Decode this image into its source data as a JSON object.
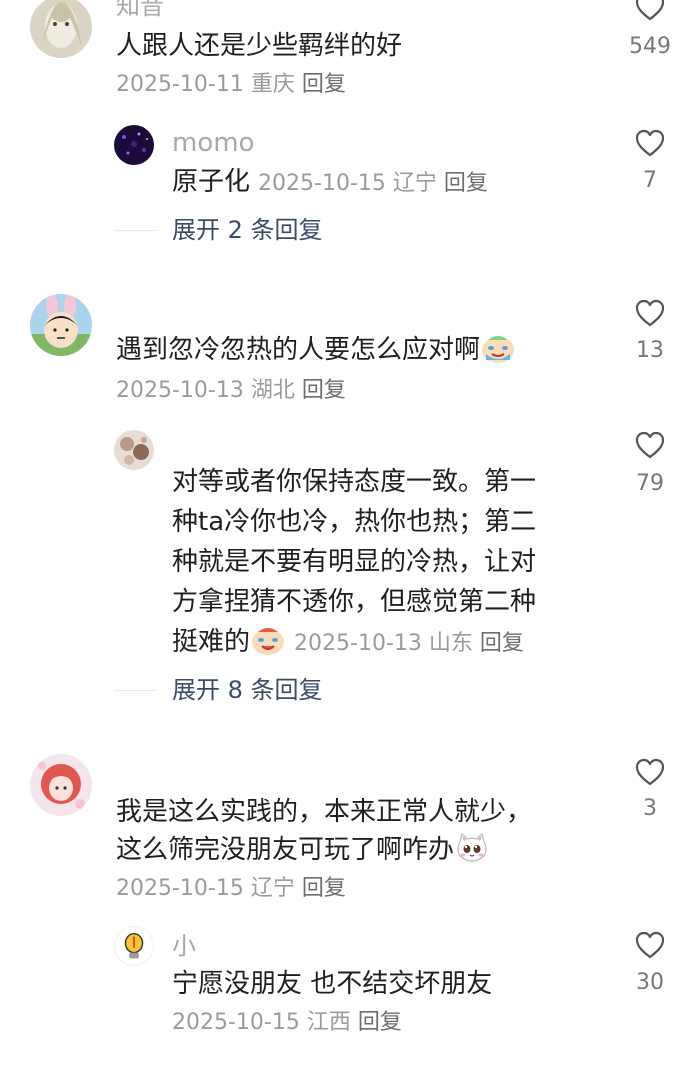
{
  "comments": [
    {
      "id": "c1",
      "name": "知音",
      "text": "人跟人还是少些羁绊的好",
      "date": "2025-10-11",
      "location": "重庆",
      "reply": "回复",
      "likes": "549",
      "replies": [
        {
          "name": "momo",
          "text": "原子化",
          "date": "2025-10-15",
          "location": "辽宁",
          "reply": "回复",
          "likes": "7"
        }
      ],
      "expand": "展开 2 条回复"
    },
    {
      "id": "c2",
      "name": "",
      "text": "遇到忽冷忽热的人要怎么应对啊",
      "date": "2025-10-13",
      "location": "湖北",
      "reply": "回复",
      "likes": "13",
      "replies": [
        {
          "name": "",
          "lines": [
            "对等或者你保持态度一致。第一",
            "种ta冷你也冷，热你也热；第二",
            "种就是不要有明显的冷热，让对",
            "方拿捏猜不透你，但感觉第二种",
            "挺难的"
          ],
          "date": "2025-10-13",
          "location": "山东",
          "reply": "回复",
          "likes": "79"
        }
      ],
      "expand": "展开 8 条回复"
    },
    {
      "id": "c3",
      "name": "",
      "lines": [
        "我是这么实践的，本来正常人就少，",
        "这么筛完没朋友可玩了啊咋办"
      ],
      "date": "2025-10-15",
      "location": "辽宁",
      "reply": "回复",
      "likes": "3",
      "replies": [
        {
          "name": "小",
          "text": "宁愿没朋友 也不结交坏朋友",
          "date": "2025-10-15",
          "location": "江西",
          "reply": "回复",
          "likes": "30"
        }
      ]
    }
  ],
  "icons": {
    "like": "heart-outline-icon",
    "emoji_crying_laugh": "crying-face-emoji",
    "emoji_cat": "cat-tear-emoji"
  },
  "colors": {
    "text": "#1f1f1f",
    "meta": "#9b9b9b",
    "expand": "#3b4a66",
    "heart": "#555555"
  }
}
